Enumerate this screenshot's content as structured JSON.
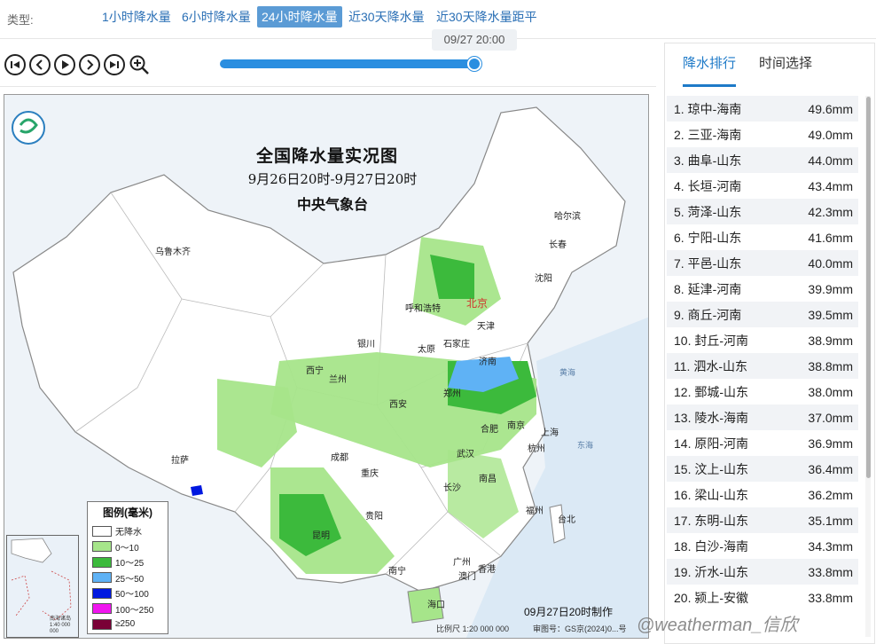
{
  "type_bar": {
    "label": "类型:",
    "options": [
      "1小时降水量",
      "6小时降水量",
      "24小时降水量",
      "近30天降水量",
      "近30天降水量距平"
    ],
    "active_index": 2
  },
  "player": {
    "timestamp": "09/27 20:00",
    "progress": 1.0
  },
  "map": {
    "title": "全国降水量实况图",
    "subtitle": "9月26日20时-9月27日20时",
    "agency": "中央气象台",
    "made_at": "09月27日20时制作",
    "scale": "比例尺 1:20 000 000",
    "review_no": "审图号：GS京(2024)0...号",
    "inset_caption": "南海诸岛 1:40 000 000",
    "capital": "北京",
    "cities": [
      "乌鲁木齐",
      "呼和浩特",
      "天津",
      "银川",
      "太原",
      "石家庄",
      "西宁",
      "兰州",
      "济南",
      "郑州",
      "西安",
      "合肥",
      "南京",
      "上海",
      "杭州",
      "成都",
      "武汉",
      "重庆",
      "南昌",
      "长沙",
      "拉萨",
      "贵阳",
      "福州",
      "台北",
      "昆明",
      "南宁",
      "广州",
      "香港",
      "澳门",
      "海口",
      "哈尔滨",
      "长春",
      "沈阳"
    ],
    "seas": [
      "黄海",
      "东海"
    ],
    "legend": {
      "title": "图例(毫米)",
      "items": [
        {
          "label": "无降水",
          "color": "#ffffff"
        },
        {
          "label": "0～10",
          "color": "#a6e58a"
        },
        {
          "label": "10～25",
          "color": "#3cba3c"
        },
        {
          "label": "25～50",
          "color": "#5fb2f5"
        },
        {
          "label": "50～100",
          "color": "#0018e0"
        },
        {
          "label": "100～250",
          "color": "#f016ef"
        },
        {
          "label": "≥250",
          "color": "#7a0036"
        }
      ]
    }
  },
  "panel": {
    "tabs": [
      "降水排行",
      "时间选择"
    ],
    "active_tab": 0,
    "ranking": [
      {
        "rank": "1.",
        "name": "琼中-海南",
        "value": "49.6mm"
      },
      {
        "rank": "2.",
        "name": "三亚-海南",
        "value": "49.0mm"
      },
      {
        "rank": "3.",
        "name": "曲阜-山东",
        "value": "44.0mm"
      },
      {
        "rank": "4.",
        "name": "长垣-河南",
        "value": "43.4mm"
      },
      {
        "rank": "5.",
        "name": "菏泽-山东",
        "value": "42.3mm"
      },
      {
        "rank": "6.",
        "name": "宁阳-山东",
        "value": "41.6mm"
      },
      {
        "rank": "7.",
        "name": "平邑-山东",
        "value": "40.0mm"
      },
      {
        "rank": "8.",
        "name": "延津-河南",
        "value": "39.9mm"
      },
      {
        "rank": "9.",
        "name": "商丘-河南",
        "value": "39.5mm"
      },
      {
        "rank": "10.",
        "name": "封丘-河南",
        "value": "38.9mm"
      },
      {
        "rank": "11.",
        "name": "泗水-山东",
        "value": "38.8mm"
      },
      {
        "rank": "12.",
        "name": "鄄城-山东",
        "value": "38.0mm"
      },
      {
        "rank": "13.",
        "name": "陵水-海南",
        "value": "37.0mm"
      },
      {
        "rank": "14.",
        "name": "原阳-河南",
        "value": "36.9mm"
      },
      {
        "rank": "15.",
        "name": "汶上-山东",
        "value": "36.4mm"
      },
      {
        "rank": "16.",
        "name": "梁山-山东",
        "value": "36.2mm"
      },
      {
        "rank": "17.",
        "name": "东明-山东",
        "value": "35.1mm"
      },
      {
        "rank": "18.",
        "name": "白沙-海南",
        "value": "34.3mm"
      },
      {
        "rank": "19.",
        "name": "沂水-山东",
        "value": "33.8mm"
      },
      {
        "rank": "20.",
        "name": "颍上-安徽",
        "value": "33.8mm"
      }
    ]
  },
  "watermark": "@weatherman_信欣"
}
